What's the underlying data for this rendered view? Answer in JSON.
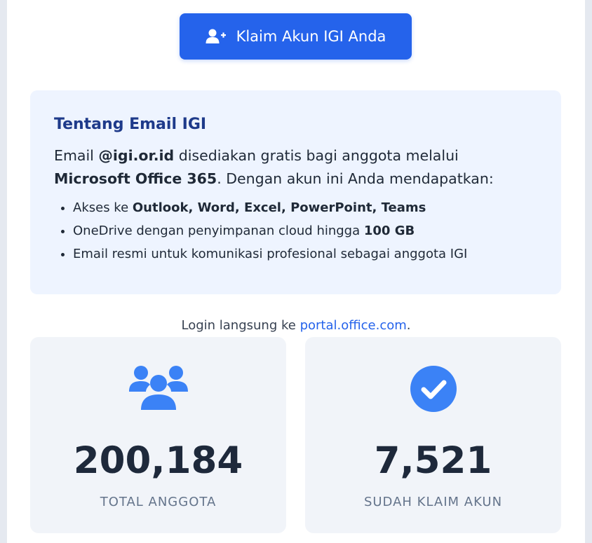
{
  "claim_button": {
    "label": "Klaim Akun IGI Anda",
    "icon": "user-plus-icon"
  },
  "info": {
    "title": "Tentang Email IGI",
    "intro_1": "Email ",
    "intro_domain": "@igi.or.id",
    "intro_2": " disediakan gratis bagi anggota melalui ",
    "intro_product": "Microsoft Office 365",
    "intro_3": ". Dengan akun ini Anda mendapatkan:",
    "items": [
      {
        "text": "Akses ke ",
        "bold": "Outlook, Word, Excel, PowerPoint, Teams",
        "after": ""
      },
      {
        "text": "OneDrive dengan penyimpanan cloud hingga ",
        "bold": "100 GB",
        "after": ""
      },
      {
        "text": "Email resmi untuk komunikasi profesional sebagai anggota IGI",
        "bold": "",
        "after": ""
      }
    ]
  },
  "login": {
    "prefix": "Login langsung ke ",
    "link_text": "portal.office.com",
    "suffix": "."
  },
  "stats": [
    {
      "value": "200,184",
      "label": "TOTAL ANGGOTA",
      "icon": "users-icon"
    },
    {
      "value": "7,521",
      "label": "SUDAH KLAIM AKUN",
      "icon": "check-circle-icon"
    }
  ],
  "colors": {
    "accent": "#2563eb",
    "icon_blue": "#3b82f6",
    "title_navy": "#1e3a8a"
  }
}
